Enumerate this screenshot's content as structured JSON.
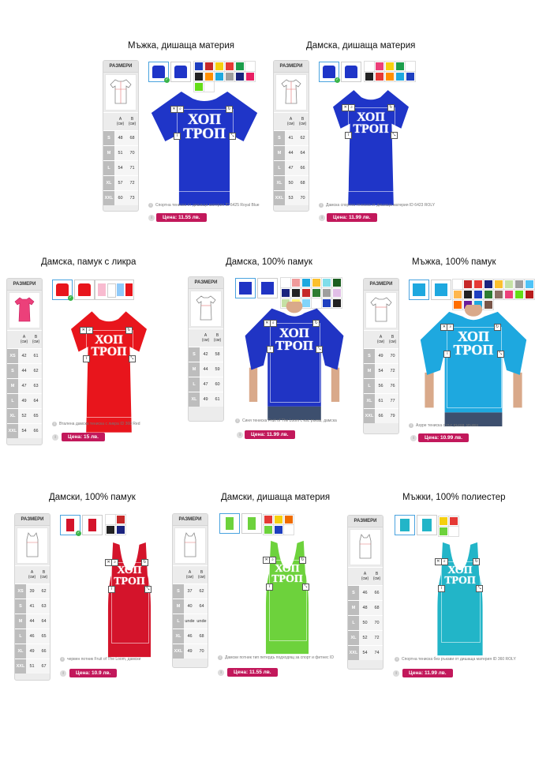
{
  "colors": {
    "accent": "#c2185b",
    "check": "#3ab54a"
  },
  "common": {
    "sizes_header": "РАЗМЕРИ",
    "col_a": "A",
    "col_b": "B",
    "col_unit": "(см)",
    "logo_line1": "ХОП",
    "logo_line2": "ТРОП"
  },
  "products": [
    {
      "title": "Мъжка, дишаща материя",
      "shirt_color": "#1f35c8",
      "desc": "Спортна тениска от дишаща материя ID 6425 Royal Blue",
      "price": "Цена: 11.55 лв.",
      "rows": [
        [
          "S",
          "48",
          "68"
        ],
        [
          "M",
          "51",
          "70"
        ],
        [
          "L",
          "54",
          "71"
        ],
        [
          "XL",
          "57",
          "72"
        ],
        [
          "XXL",
          "60",
          "73"
        ]
      ]
    },
    {
      "title": "Дамска, дишаща материя",
      "shirt_color": "#1f35c8",
      "desc": "Дамска спортна тениска от дишаща материя ID 6423 ROLY",
      "price": "Цена: 11.99 лв.",
      "rows": [
        [
          "S",
          "41",
          "62"
        ],
        [
          "M",
          "44",
          "64"
        ],
        [
          "L",
          "47",
          "66"
        ],
        [
          "XL",
          "50",
          "68"
        ],
        [
          "XXL",
          "53",
          "70"
        ]
      ]
    },
    {
      "title": "Дамска, памук с ликра",
      "shirt_color": "#e8151c",
      "desc": "Вталена дамска тениска с ликра ID 360 Red",
      "price": "Цена: 15 лв.",
      "rows": [
        [
          "XS",
          "42",
          "61"
        ],
        [
          "S",
          "44",
          "62"
        ],
        [
          "M",
          "47",
          "63"
        ],
        [
          "L",
          "49",
          "64"
        ],
        [
          "XL",
          "52",
          "65"
        ],
        [
          "XXL",
          "54",
          "66"
        ]
      ]
    },
    {
      "title": "Дамска, 100% памук",
      "shirt_color": "#2034c4",
      "desc": "Синя тениска Fruit of The Loom с къс ръкав, дамска",
      "price": "Цена: 11.99 лв.",
      "rows": [
        [
          "S",
          "42",
          "58"
        ],
        [
          "M",
          "44",
          "59"
        ],
        [
          "L",
          "47",
          "60"
        ],
        [
          "XL",
          "49",
          "61"
        ]
      ]
    },
    {
      "title": "Мъжка, 100% памук",
      "shirt_color": "#1ea8df",
      "desc": "Азуре тениска с къс ръкав, мъжка",
      "price": "Цена: 10.99 лв.",
      "rows": [
        [
          "S",
          "49",
          "70"
        ],
        [
          "M",
          "54",
          "72"
        ],
        [
          "L",
          "56",
          "76"
        ],
        [
          "XL",
          "61",
          "77"
        ],
        [
          "XXL",
          "66",
          "79"
        ]
      ]
    },
    {
      "title": "Дамски, 100% памук",
      "shirt_color": "#d4142b",
      "desc": "червен потник Fruit of The Loom, дамски",
      "price": "Цена: 10.9 лв.",
      "rows": [
        [
          "XS",
          "39",
          "62"
        ],
        [
          "S",
          "41",
          "63"
        ],
        [
          "M",
          "44",
          "64"
        ],
        [
          "L",
          "46",
          "65"
        ],
        [
          "XL",
          "49",
          "66"
        ],
        [
          "XXL",
          "51",
          "67"
        ]
      ]
    },
    {
      "title": "Дамски, дишаща материя",
      "shirt_color": "#6dd23c",
      "desc": "Дамски потник тип петердъ подходящ за спорт и фитнес ID",
      "price": "Цена: 11.55 лв.",
      "rows": [
        [
          "S",
          "37",
          "62"
        ],
        [
          "M",
          "40",
          "64"
        ],
        [
          "L",
          "unde",
          "unde"
        ],
        [
          "XL",
          "46",
          "68"
        ],
        [
          "XXL",
          "49",
          "70"
        ]
      ]
    },
    {
      "title": "Мъжки, 100% полиестер",
      "shirt_color": "#22b5c8",
      "desc": "Спортна тениска без ръкави от дишаща материя ID 360 ROLY",
      "price": "Цена: 11.99 лв.",
      "rows": [
        [
          "S",
          "46",
          "66"
        ],
        [
          "M",
          "48",
          "68"
        ],
        [
          "L",
          "50",
          "70"
        ],
        [
          "XL",
          "52",
          "72"
        ],
        [
          "XXL",
          "54",
          "74"
        ]
      ]
    }
  ],
  "swatch_sets": {
    "p0": [
      "#1e3fc0",
      "#c62828",
      "#f5d00f",
      "#e53935",
      "#1b9e4b",
      "#ffffff",
      "#222222",
      "#ff8f00",
      "#1ea8df",
      "#9e9e9e",
      "#1a237e",
      "#e91e63",
      "#64dd17",
      "#ffffff"
    ],
    "p1": [
      "#ffffff",
      "#ec407a",
      "#f5d00f",
      "#1b9e4b",
      "#ffffff",
      "#222222",
      "#e53935",
      "#ff8f00",
      "#1ea8df",
      "#1e3fc0"
    ],
    "p3": [
      "#ffffff",
      "#ef9a9a",
      "#1ea8df",
      "#fbc02d",
      "#80deea",
      "#1b5e20",
      "#1a237e",
      "#222222",
      "#c62828",
      "#2e7d32",
      "#9e9e9e",
      "#e1bee7",
      "#c5e1a5",
      "#fff176",
      "#81d4fa",
      "#ffffff",
      "#1e3fc0",
      "#212121"
    ],
    "p4": [
      "#ffffff",
      "#c62828",
      "#e53935",
      "#1a237e",
      "#fbc02d",
      "#c5e1a5",
      "#9e9e9e",
      "#4fc3f7",
      "#ffb74d",
      "#222222",
      "#1e3fc0",
      "#2e7d32",
      "#8d6e63",
      "#ec407a",
      "#64dd17",
      "#b71c1c",
      "#ff6f00",
      "#6a1b9a",
      "#1ea8df",
      "#795548"
    ],
    "p5": [
      "#ffffff",
      "#c62828",
      "#222222",
      "#1a237e"
    ],
    "p6": [
      "#e53935",
      "#f5d00f",
      "#ef6c00",
      "#6dd23c",
      "#1e3fc0",
      "#ffffff"
    ],
    "p7": [
      "#f5d00f",
      "#e53935",
      "#6dd23c",
      "#ffffff"
    ]
  }
}
